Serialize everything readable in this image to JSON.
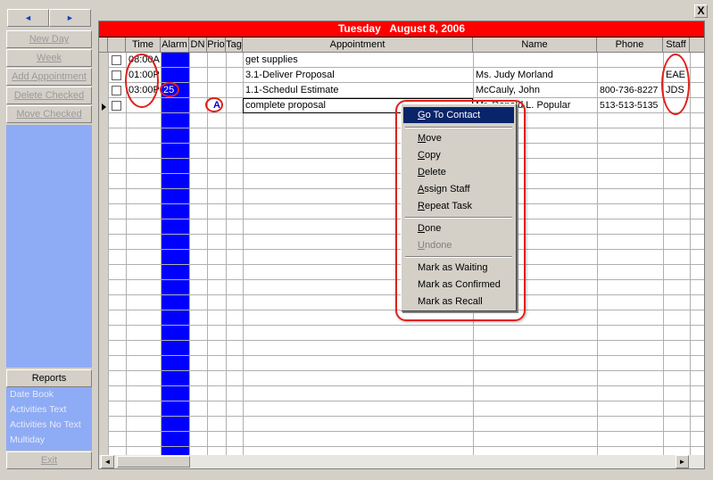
{
  "nav": {
    "prev_label": "◄",
    "next_label": "►"
  },
  "sidebar": {
    "buttons": [
      "New Day",
      "Week",
      "Add Appointment",
      "Delete Checked",
      "Move Checked"
    ],
    "reports_label": "Reports",
    "report_links": [
      "Date Book",
      "Activities Text",
      "Activities No Text",
      "Multiday"
    ],
    "exit_label": "Exit"
  },
  "window": {
    "close_label": "X"
  },
  "schedule": {
    "date_label": "Tuesday   August 8, 2006",
    "columns": [
      "Time",
      "Alarm",
      "DN",
      "Prio",
      "Tag",
      "Appointment",
      "Name",
      "Phone",
      "Staff"
    ],
    "rows": [
      {
        "time": "08:00A",
        "alarm": "",
        "prio": "",
        "appointment": "get supplies",
        "name": "",
        "phone": "",
        "staff": ""
      },
      {
        "time": "01:00P",
        "alarm": "",
        "prio": "",
        "appointment": "3.1-Deliver Proposal",
        "name": "Ms. Judy Morland",
        "phone": "",
        "staff": "EAE"
      },
      {
        "time": "03:00P",
        "alarm": "25",
        "prio": "",
        "appointment": "1.1-Schedul Estimate",
        "name": "McCauly, John",
        "phone": "800-736-8227",
        "staff": "JDS"
      },
      {
        "time": "",
        "alarm": "",
        "prio": "A",
        "appointment": "complete proposal",
        "name": "Mr. Donald L. Popular",
        "phone": "513-513-5135",
        "staff": ""
      }
    ],
    "colors": {
      "date_bar": "#ff0000",
      "alarm_column": "#0000ff",
      "sidebar_panel": "#8eabf5",
      "highlight_ring": "#e0201a"
    }
  },
  "context_menu": {
    "items": [
      {
        "label": "Go To Contact",
        "accel": "G",
        "rest": "o To Contact",
        "state": "selected"
      },
      {
        "label": "Move",
        "accel": "M",
        "rest": "ove",
        "state": "normal"
      },
      {
        "label": "Copy",
        "accel": "C",
        "rest": "opy",
        "state": "normal"
      },
      {
        "label": "Delete",
        "accel": "D",
        "rest": "elete",
        "state": "normal"
      },
      {
        "label": "Assign Staff",
        "accel": "A",
        "rest": "ssign Staff",
        "state": "normal"
      },
      {
        "label": "Repeat Task",
        "accel": "R",
        "rest": "epeat Task",
        "state": "normal"
      },
      {
        "label": "Done",
        "accel": "D",
        "rest": "one",
        "state": "normal"
      },
      {
        "label": "Undone",
        "accel": "U",
        "rest": "ndone",
        "state": "disabled"
      },
      {
        "label": "Mark as Waiting",
        "accel": "",
        "rest": "Mark as Waiting",
        "state": "normal"
      },
      {
        "label": "Mark as Confirmed",
        "accel": "",
        "rest": "Mark as Confirmed",
        "state": "normal"
      },
      {
        "label": "Mark as Recall",
        "accel": "",
        "rest": "Mark as Recall",
        "state": "normal"
      }
    ]
  }
}
